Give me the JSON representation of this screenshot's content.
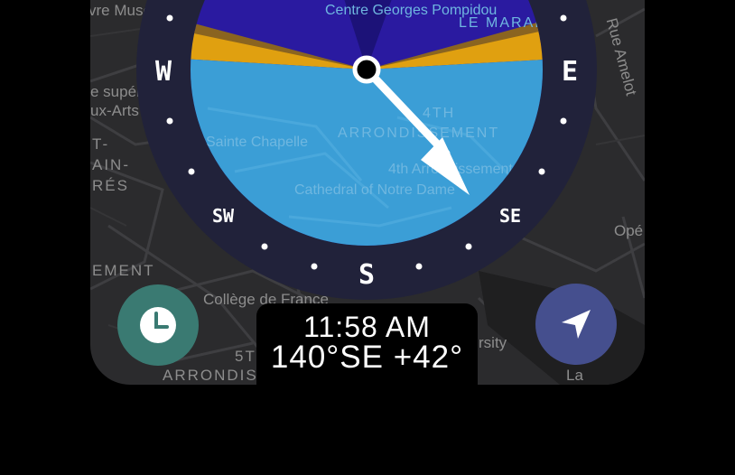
{
  "map": {
    "labels": [
      "vre Musée",
      "Centre Georges Pompidou",
      "LE MARAIS",
      "Rue Amelot",
      "e supér",
      "ux-Arts",
      "T-",
      "AIN-",
      "RÉS",
      "Sainte Chapelle",
      "4TH",
      "ARRONDISSEMENT",
      "4th Arrondissement",
      "Cathedral of Notre Dame",
      "Opé",
      "EMENT",
      "Collège de France",
      "5T",
      "ARRONDIS",
      "rsity",
      "La"
    ]
  },
  "compass": {
    "cardinals": {
      "west": "W",
      "east": "E",
      "south": "S"
    },
    "intercardinals": {
      "southwest": "SW",
      "southeast": "SE"
    },
    "needle_bearing_deg": 140,
    "colors": {
      "ring": "#21223a",
      "sky": "#3b9ed6",
      "night": "#2a1aa0",
      "deep_night": "#1c1278",
      "twilight": "#e0a010",
      "needle": "#ffffff"
    }
  },
  "readout": {
    "time": "11:58 AM",
    "heading": "140°SE +42°"
  },
  "buttons": {
    "time_icon": "clock-icon",
    "locate_icon": "navigation-arrow-icon"
  }
}
